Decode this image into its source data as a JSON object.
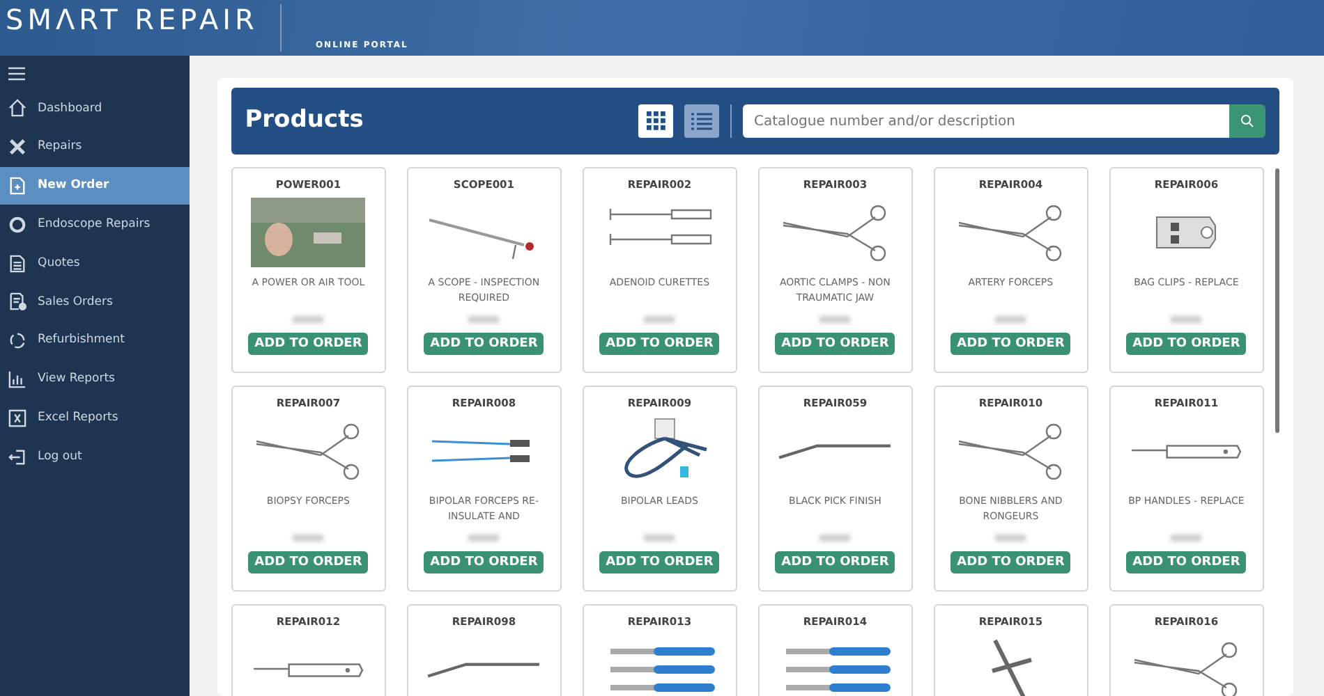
{
  "header": {
    "logo": "SMΛRT REPAIR",
    "portal_caption": "ONLINE PORTAL"
  },
  "sidebar": {
    "items": [
      {
        "label": "Dashboard",
        "kind": "home",
        "selected": false
      },
      {
        "label": "Repairs",
        "kind": "tools",
        "selected": false
      },
      {
        "label": "New Order",
        "kind": "newdoc",
        "selected": true
      },
      {
        "label": "Endoscope Repairs",
        "kind": "ring",
        "selected": false
      },
      {
        "label": "Quotes",
        "kind": "doc",
        "selected": false
      },
      {
        "label": "Sales Orders",
        "kind": "docmoney",
        "selected": false
      },
      {
        "label": "Refurbishment",
        "kind": "cycle",
        "selected": false
      },
      {
        "label": "View Reports",
        "kind": "chart",
        "selected": false
      },
      {
        "label": "Excel Reports",
        "kind": "excel",
        "selected": false
      },
      {
        "label": "Log out",
        "kind": "logout",
        "selected": false
      }
    ]
  },
  "products_panel": {
    "title": "Products",
    "view_modes": [
      {
        "kind": "grid",
        "selected": true
      },
      {
        "kind": "list",
        "selected": false
      }
    ],
    "search": {
      "placeholder": "Catalogue number and/or description"
    },
    "products": [
      {
        "code": "POWER001",
        "kind": "photo",
        "name": "A POWER OR AIR TOOL",
        "button": "ADD TO ORDER"
      },
      {
        "code": "SCOPE001",
        "kind": "scope",
        "name": "A SCOPE - INSPECTION REQUIRED",
        "button": "ADD TO ORDER"
      },
      {
        "code": "REPAIR002",
        "kind": "curettes",
        "name": "ADENOID CURETTES",
        "button": "ADD TO ORDER"
      },
      {
        "code": "REPAIR003",
        "kind": "forceps",
        "name": "AORTIC CLAMPS - NON TRAUMATIC JAW",
        "button": "ADD TO ORDER"
      },
      {
        "code": "REPAIR004",
        "kind": "forceps",
        "name": "ARTERY FORCEPS",
        "button": "ADD TO ORDER"
      },
      {
        "code": "REPAIR006",
        "kind": "clip",
        "name": "BAG CLIPS - REPLACE",
        "button": "ADD TO ORDER"
      },
      {
        "code": "REPAIR007",
        "kind": "forceps",
        "name": "BIOPSY FORCEPS",
        "button": "ADD TO ORDER"
      },
      {
        "code": "REPAIR008",
        "kind": "bipolar",
        "name": "BIPOLAR FORCEPS RE-INSULATE AND",
        "button": "ADD TO ORDER"
      },
      {
        "code": "REPAIR009",
        "kind": "leads",
        "name": "BIPOLAR LEADS",
        "button": "ADD TO ORDER"
      },
      {
        "code": "REPAIR059",
        "kind": "pick",
        "name": "BLACK PICK FINISH",
        "button": "ADD TO ORDER"
      },
      {
        "code": "REPAIR010",
        "kind": "forceps",
        "name": "BONE NIBBLERS AND RONGEURS",
        "button": "ADD TO ORDER"
      },
      {
        "code": "REPAIR011",
        "kind": "handle",
        "name": "BP HANDLES - REPLACE",
        "button": "ADD TO ORDER"
      },
      {
        "code": "REPAIR012",
        "kind": "handle"
      },
      {
        "code": "REPAIR098",
        "kind": "pick"
      },
      {
        "code": "REPAIR013",
        "kind": "chisels"
      },
      {
        "code": "REPAIR014",
        "kind": "chisels"
      },
      {
        "code": "REPAIR015",
        "kind": "tbar"
      },
      {
        "code": "REPAIR016",
        "kind": "forceps"
      }
    ]
  }
}
